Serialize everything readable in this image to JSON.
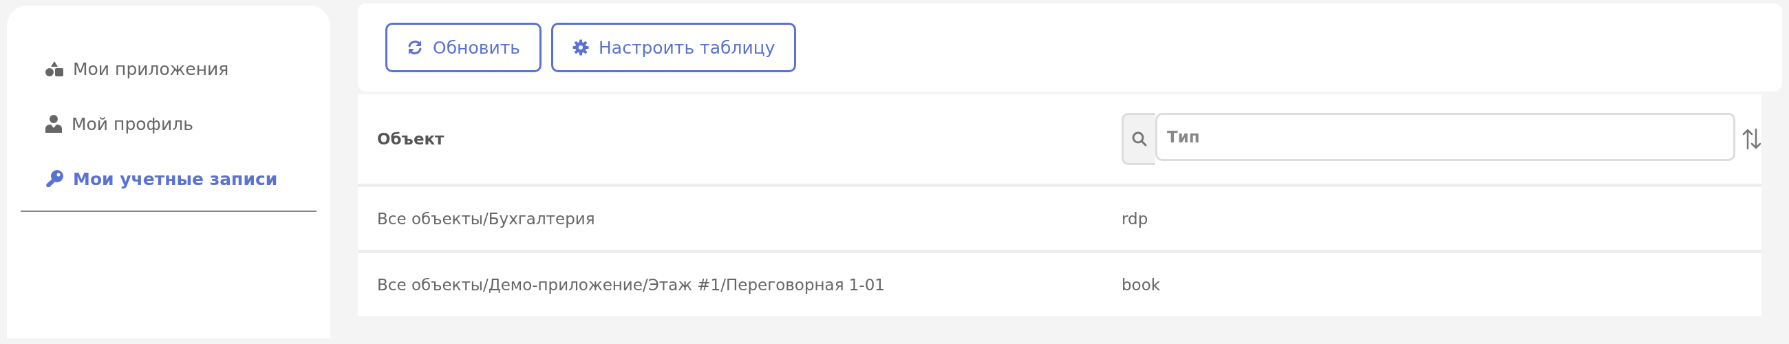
{
  "sidebar": {
    "items": [
      {
        "label": "Мои приложения",
        "kind": "shapes",
        "selected": false
      },
      {
        "label": "Мой профиль",
        "kind": "user",
        "selected": false
      },
      {
        "label": "Мои учетные записи",
        "kind": "key",
        "selected": true
      }
    ]
  },
  "toolbar": {
    "buttons": [
      {
        "label": "Обновить",
        "kind": "refresh"
      },
      {
        "label": "Настроить таблицу",
        "kind": "gear"
      }
    ]
  },
  "table": {
    "columns": [
      {
        "label": "Объект"
      },
      {
        "kind": "filter",
        "placeholder": "Тип"
      }
    ],
    "rows": [
      [
        "Все объекты/Бухгалтерия",
        "rdp"
      ],
      [
        "Все объекты/Демо-приложение/Этаж #1/Переговорная 1-01",
        "book"
      ]
    ]
  }
}
